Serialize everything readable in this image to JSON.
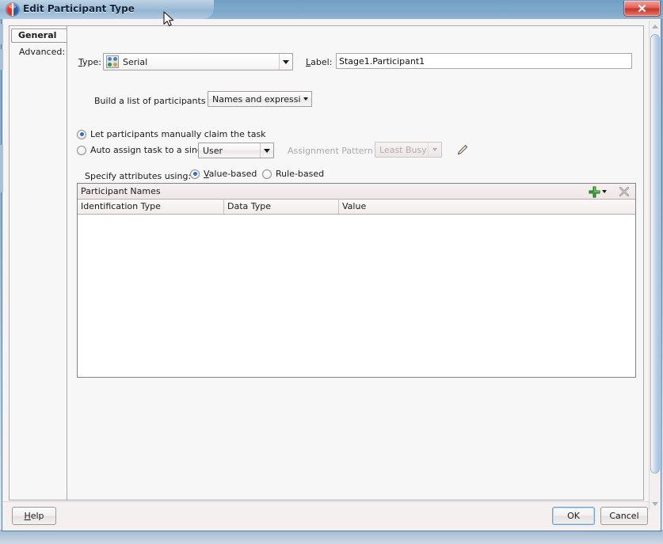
{
  "window": {
    "title": "Edit Participant Type",
    "icon": "oracle-sphere-icon",
    "close_label": "x"
  },
  "tabs": [
    {
      "label": "General",
      "selected": true
    },
    {
      "label": "Advanced:",
      "selected": false
    }
  ],
  "form": {
    "type_label": "Type:",
    "type_value": "Serial",
    "label_label": "Label:",
    "label_value": "Stage1.Participant1",
    "build_list_label": "Build a list of participants using:",
    "build_list_value": "Names and expressions",
    "manual_claim_label": "Let participants manually claim the task",
    "auto_assign_label": "Auto assign task to a single",
    "auto_assign_value": "User",
    "assignment_pattern_label": "Assignment Pattern :",
    "assignment_pattern_value": "Least Busy",
    "edit_pattern_icon": "pencil-icon",
    "specify_attributes_label": "Specify attributes using:",
    "value_based_label": "Value-based",
    "rule_based_label": "Rule-based"
  },
  "table": {
    "title": "Participant Names",
    "add_icon": "plus-icon",
    "delete_icon": "delete-x-icon",
    "columns": [
      "Identification Type",
      "Data Type",
      "Value"
    ],
    "rows": []
  },
  "buttons": {
    "help": "Help",
    "ok": "OK",
    "cancel": "Cancel"
  },
  "colors": {
    "accent": "#2a6fc4",
    "titlebar": "#7fa8ca",
    "close_red": "#c93428",
    "panel_bg": "#f7f7f8",
    "dialog_bg": "#f3f1f0",
    "add_green": "#3ea53e"
  }
}
